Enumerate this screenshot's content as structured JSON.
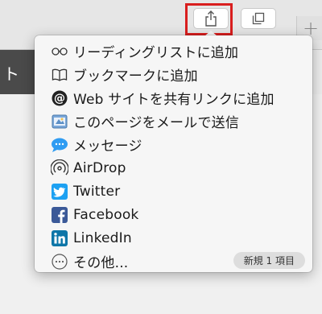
{
  "toolbar": {
    "share_icon": "share-icon",
    "tabs_icon": "tabs-overview-icon",
    "new_tab_symbol": "+"
  },
  "page": {
    "partial_text": "ト"
  },
  "share_menu": {
    "items": [
      {
        "label": "リーディングリストに追加",
        "icon": "reading-list-icon"
      },
      {
        "label": "ブックマークに追加",
        "icon": "bookmark-icon"
      },
      {
        "label": "Web サイトを共有リンクに追加",
        "icon": "shared-links-icon"
      },
      {
        "label": "このページをメールで送信",
        "icon": "mail-icon"
      },
      {
        "label": "メッセージ",
        "icon": "messages-icon"
      },
      {
        "label": "AirDrop",
        "icon": "airdrop-icon"
      },
      {
        "label": "Twitter",
        "icon": "twitter-icon"
      },
      {
        "label": "Facebook",
        "icon": "facebook-icon"
      },
      {
        "label": "LinkedIn",
        "icon": "linkedin-icon"
      },
      {
        "label": "その他...",
        "icon": "more-icon",
        "badge": "新規 1 項目"
      }
    ]
  },
  "colors": {
    "highlight": "#d91e1e",
    "twitter": "#1da1f2",
    "facebook": "#3b5998",
    "linkedin": "#0e76a8",
    "messages": "#2f9cf2"
  }
}
